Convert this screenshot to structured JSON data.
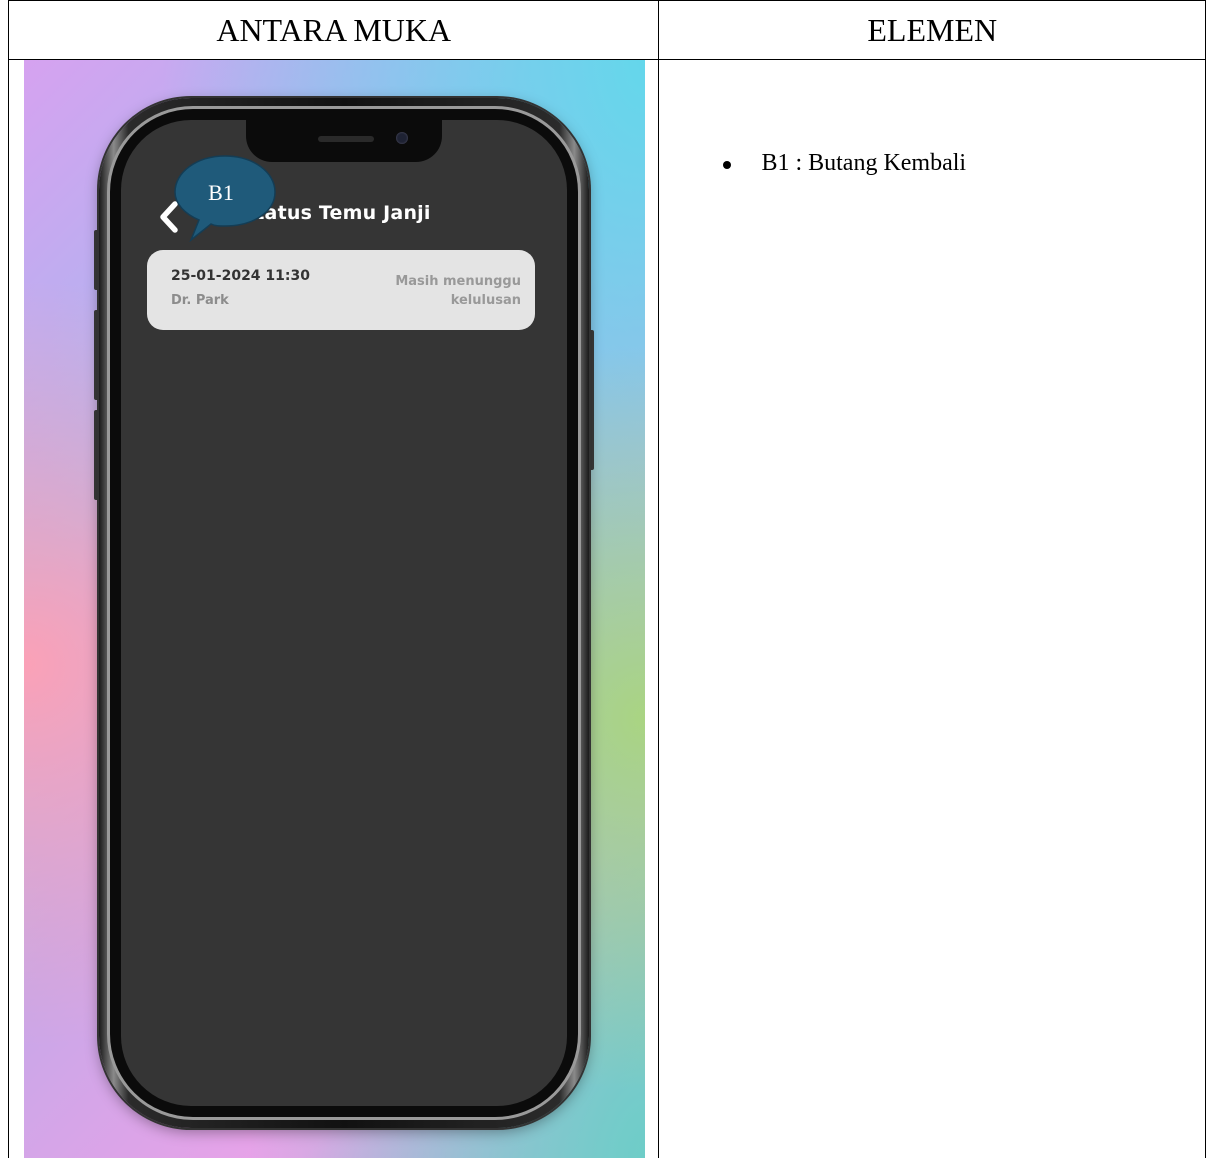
{
  "table": {
    "headers": [
      "ANTARA MUKA",
      "ELEMEN"
    ]
  },
  "app": {
    "title": "Status Temu Janji",
    "appointment": {
      "datetime": "25-01-2024 11:30",
      "doctor": "Dr. Park",
      "status": "Masih menunggu kelulusan"
    },
    "icons": [
      "back-chevron-icon"
    ]
  },
  "callout": {
    "label": "B1",
    "color": "#1f5a7a"
  },
  "elements": [
    "B1 : Butang Kembali"
  ]
}
